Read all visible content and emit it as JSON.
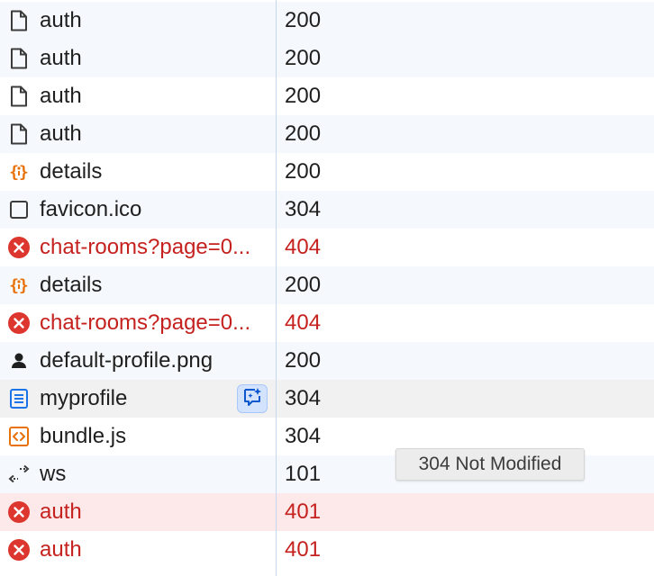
{
  "colors": {
    "error": "#c5221f",
    "text": "#1f1f1f",
    "row_stripe": "#f5f8fc",
    "row_selected": "#fde9e9",
    "divider": "#c7d7f0",
    "json_icon": "#e8710a",
    "doc_icon": "#1a73e8"
  },
  "requests": [
    {
      "name": "auth",
      "status": "200",
      "icon": "document-icon",
      "error": false
    },
    {
      "name": "auth",
      "status": "200",
      "icon": "document-icon",
      "error": false
    },
    {
      "name": "auth",
      "status": "200",
      "icon": "document-icon",
      "error": false
    },
    {
      "name": "auth",
      "status": "200",
      "icon": "document-icon",
      "error": false
    },
    {
      "name": "details",
      "status": "200",
      "icon": "json-icon",
      "error": false
    },
    {
      "name": "favicon.ico",
      "status": "304",
      "icon": "blank-file-icon",
      "error": false
    },
    {
      "name": "chat-rooms?page=0...",
      "status": "404",
      "icon": "error-icon",
      "error": true
    },
    {
      "name": "details",
      "status": "200",
      "icon": "json-icon",
      "error": false
    },
    {
      "name": "chat-rooms?page=0...",
      "status": "404",
      "icon": "error-icon",
      "error": true
    },
    {
      "name": "default-profile.png",
      "status": "200",
      "icon": "image-person-icon",
      "error": false
    },
    {
      "name": "myprofile",
      "status": "304",
      "icon": "html-document-icon",
      "error": false
    },
    {
      "name": "bundle.js",
      "status": "304",
      "icon": "script-icon",
      "error": false
    },
    {
      "name": "ws",
      "status": "101",
      "icon": "websocket-icon",
      "error": false
    },
    {
      "name": "auth",
      "status": "401",
      "icon": "error-icon",
      "error": true
    },
    {
      "name": "auth",
      "status": "401",
      "icon": "error-icon",
      "error": true
    }
  ],
  "tooltip": {
    "text": "304 Not Modified"
  },
  "ai_button": {
    "icon": "ai-assist-icon"
  }
}
